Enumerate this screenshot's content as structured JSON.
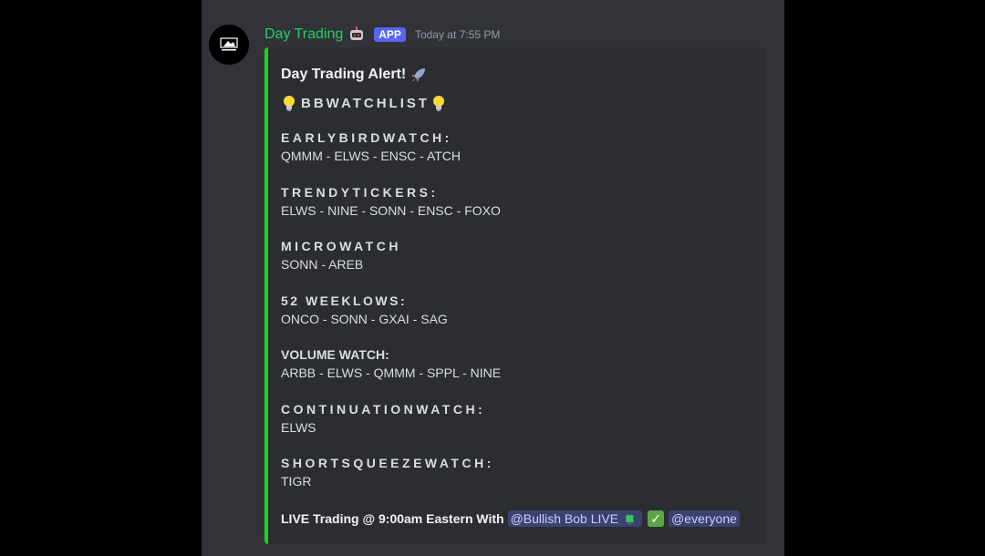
{
  "message": {
    "username": "Day Trading",
    "app_tag": "APP",
    "timestamp": "Today at 7:55 PM",
    "colors": {
      "username": "#23d160",
      "embed_bar": "#1bd21b",
      "app_tag": "#5865f2"
    }
  },
  "embed": {
    "title": "Day Trading Alert!",
    "subtitle": "BBWATCHLIST",
    "sections": [
      {
        "heading": "EARLYBIRDWATCH:",
        "tickers": "QMMM - ELWS - ENSC - ATCH"
      },
      {
        "heading": "TRENDYTICKERS:",
        "tickers": "ELWS - NINE - SONN - ENSC - FOXO"
      },
      {
        "heading": "MICROWATCH",
        "tickers": "SONN - AREB"
      },
      {
        "heading": "52 WEEKLOWS:",
        "tickers": "ONCO - SONN - GXAI - SAG"
      },
      {
        "heading": "VOLUME WATCH:",
        "tickers": "ARBB - ELWS - QMMM - SPPL - NINE"
      },
      {
        "heading": "CONTINUATIONWATCH:",
        "tickers": "ELWS"
      },
      {
        "heading": "SHORTSQUEEZEWATCH:",
        "tickers": "TIGR"
      }
    ],
    "footer": {
      "text": "LIVE Trading @ 9:00am Eastern With",
      "mention_user": "@Bullish Bob LIVE",
      "mention_all": "@everyone"
    }
  },
  "icons": {
    "title_emoji": "rocket-icon",
    "subtitle_emoji": "lightbulb-icon",
    "mention_emoji": "four-leaf-clover-icon",
    "check_emoji": "check-mark-icon",
    "bot_emoji": "robot-icon"
  }
}
